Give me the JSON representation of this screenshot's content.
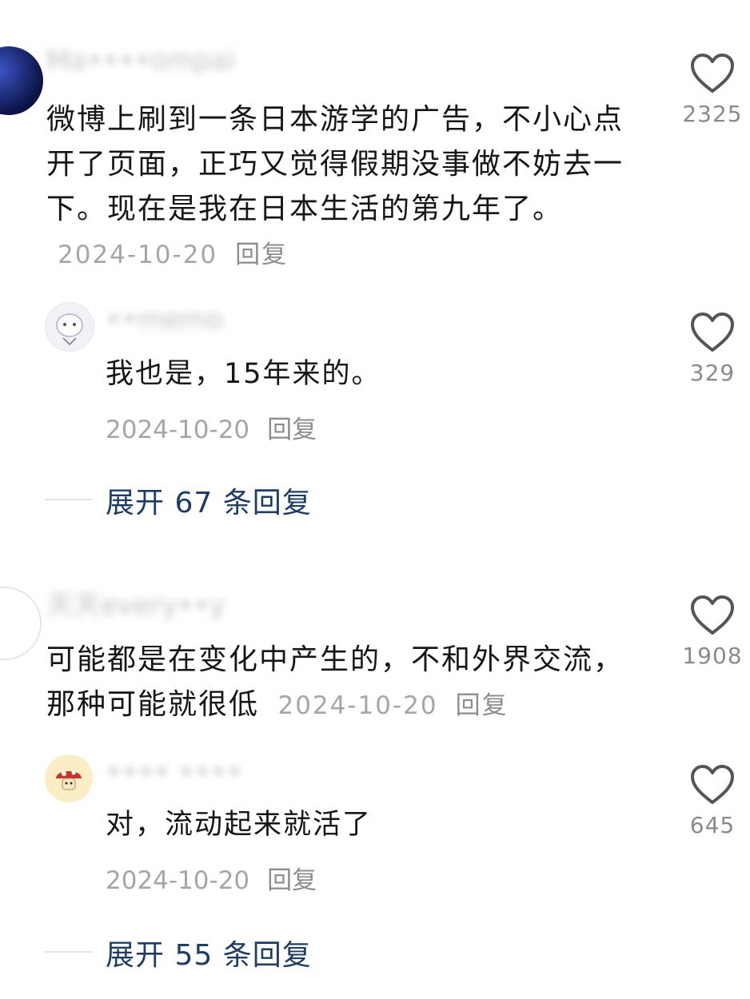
{
  "comments": [
    {
      "username": "Ma••••ompai",
      "text": "微博上刷到一条日本游学的广告，不小心点开了页面，正巧又觉得假期没事做不妨去一下。现在是我在日本生活的第九年了。",
      "date": "2024-10-20",
      "reply_label": "回复",
      "likes": "2325",
      "avatar_color": "#1a2a6c",
      "reply": {
        "username": "••memo",
        "text": "我也是，15年来的。",
        "date": "2024-10-20",
        "reply_label": "回复",
        "likes": "329"
      },
      "expand_label": "展开 67 条回复"
    },
    {
      "username": "天天every••y",
      "text": "可能都是在变化中产生的，不和外界交流，那种可能就很低",
      "date": "2024-10-20",
      "reply_label": "回复",
      "likes": "1908",
      "reply": {
        "username": "•••• ••••",
        "text": "对，流动起来就活了",
        "date": "2024-10-20",
        "reply_label": "回复",
        "likes": "645"
      },
      "expand_label": "展开 55 条回复"
    }
  ],
  "colors": {
    "expand_link": "#1f3d63",
    "meta_text": "#a6a6a6",
    "like_icon": "#555555"
  },
  "icons": [
    "heart-outline-icon"
  ]
}
